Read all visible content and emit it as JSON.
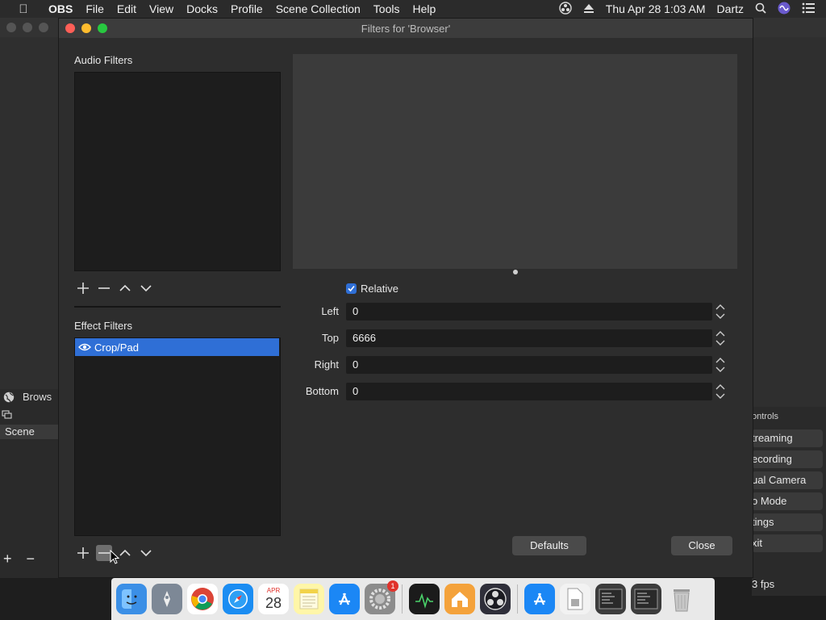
{
  "menubar": {
    "app_name": "OBS",
    "items": [
      "File",
      "Edit",
      "View",
      "Docks",
      "Profile",
      "Scene Collection",
      "Tools",
      "Help"
    ],
    "datetime": "Thu Apr 28  1:03 AM",
    "user": "Dartz"
  },
  "background": {
    "source_name": "Brows",
    "scenes_label": "Scene",
    "controls_title": "ontrols",
    "controls": [
      "treaming",
      "ecording",
      "ual Camera",
      "o Mode",
      "tings",
      "xit"
    ],
    "fps": "3 fps"
  },
  "dialog": {
    "title": "Filters for 'Browser'",
    "audio_filters_label": "Audio Filters",
    "effect_filters_label": "Effect Filters",
    "effect_filters": [
      "Crop/Pad"
    ],
    "relative_label": "Relative",
    "relative_checked": true,
    "properties": [
      {
        "label": "Left",
        "value": "0"
      },
      {
        "label": "Top",
        "value": "6666"
      },
      {
        "label": "Right",
        "value": "0"
      },
      {
        "label": "Bottom",
        "value": "0"
      }
    ],
    "defaults_label": "Defaults",
    "close_label": "Close"
  },
  "dock": {
    "calendar_month": "APR",
    "calendar_day": "28",
    "system_prefs_badge": "1"
  },
  "colors": {
    "selection": "#2f6fd6",
    "dialog_bg": "#2d2d2d"
  }
}
